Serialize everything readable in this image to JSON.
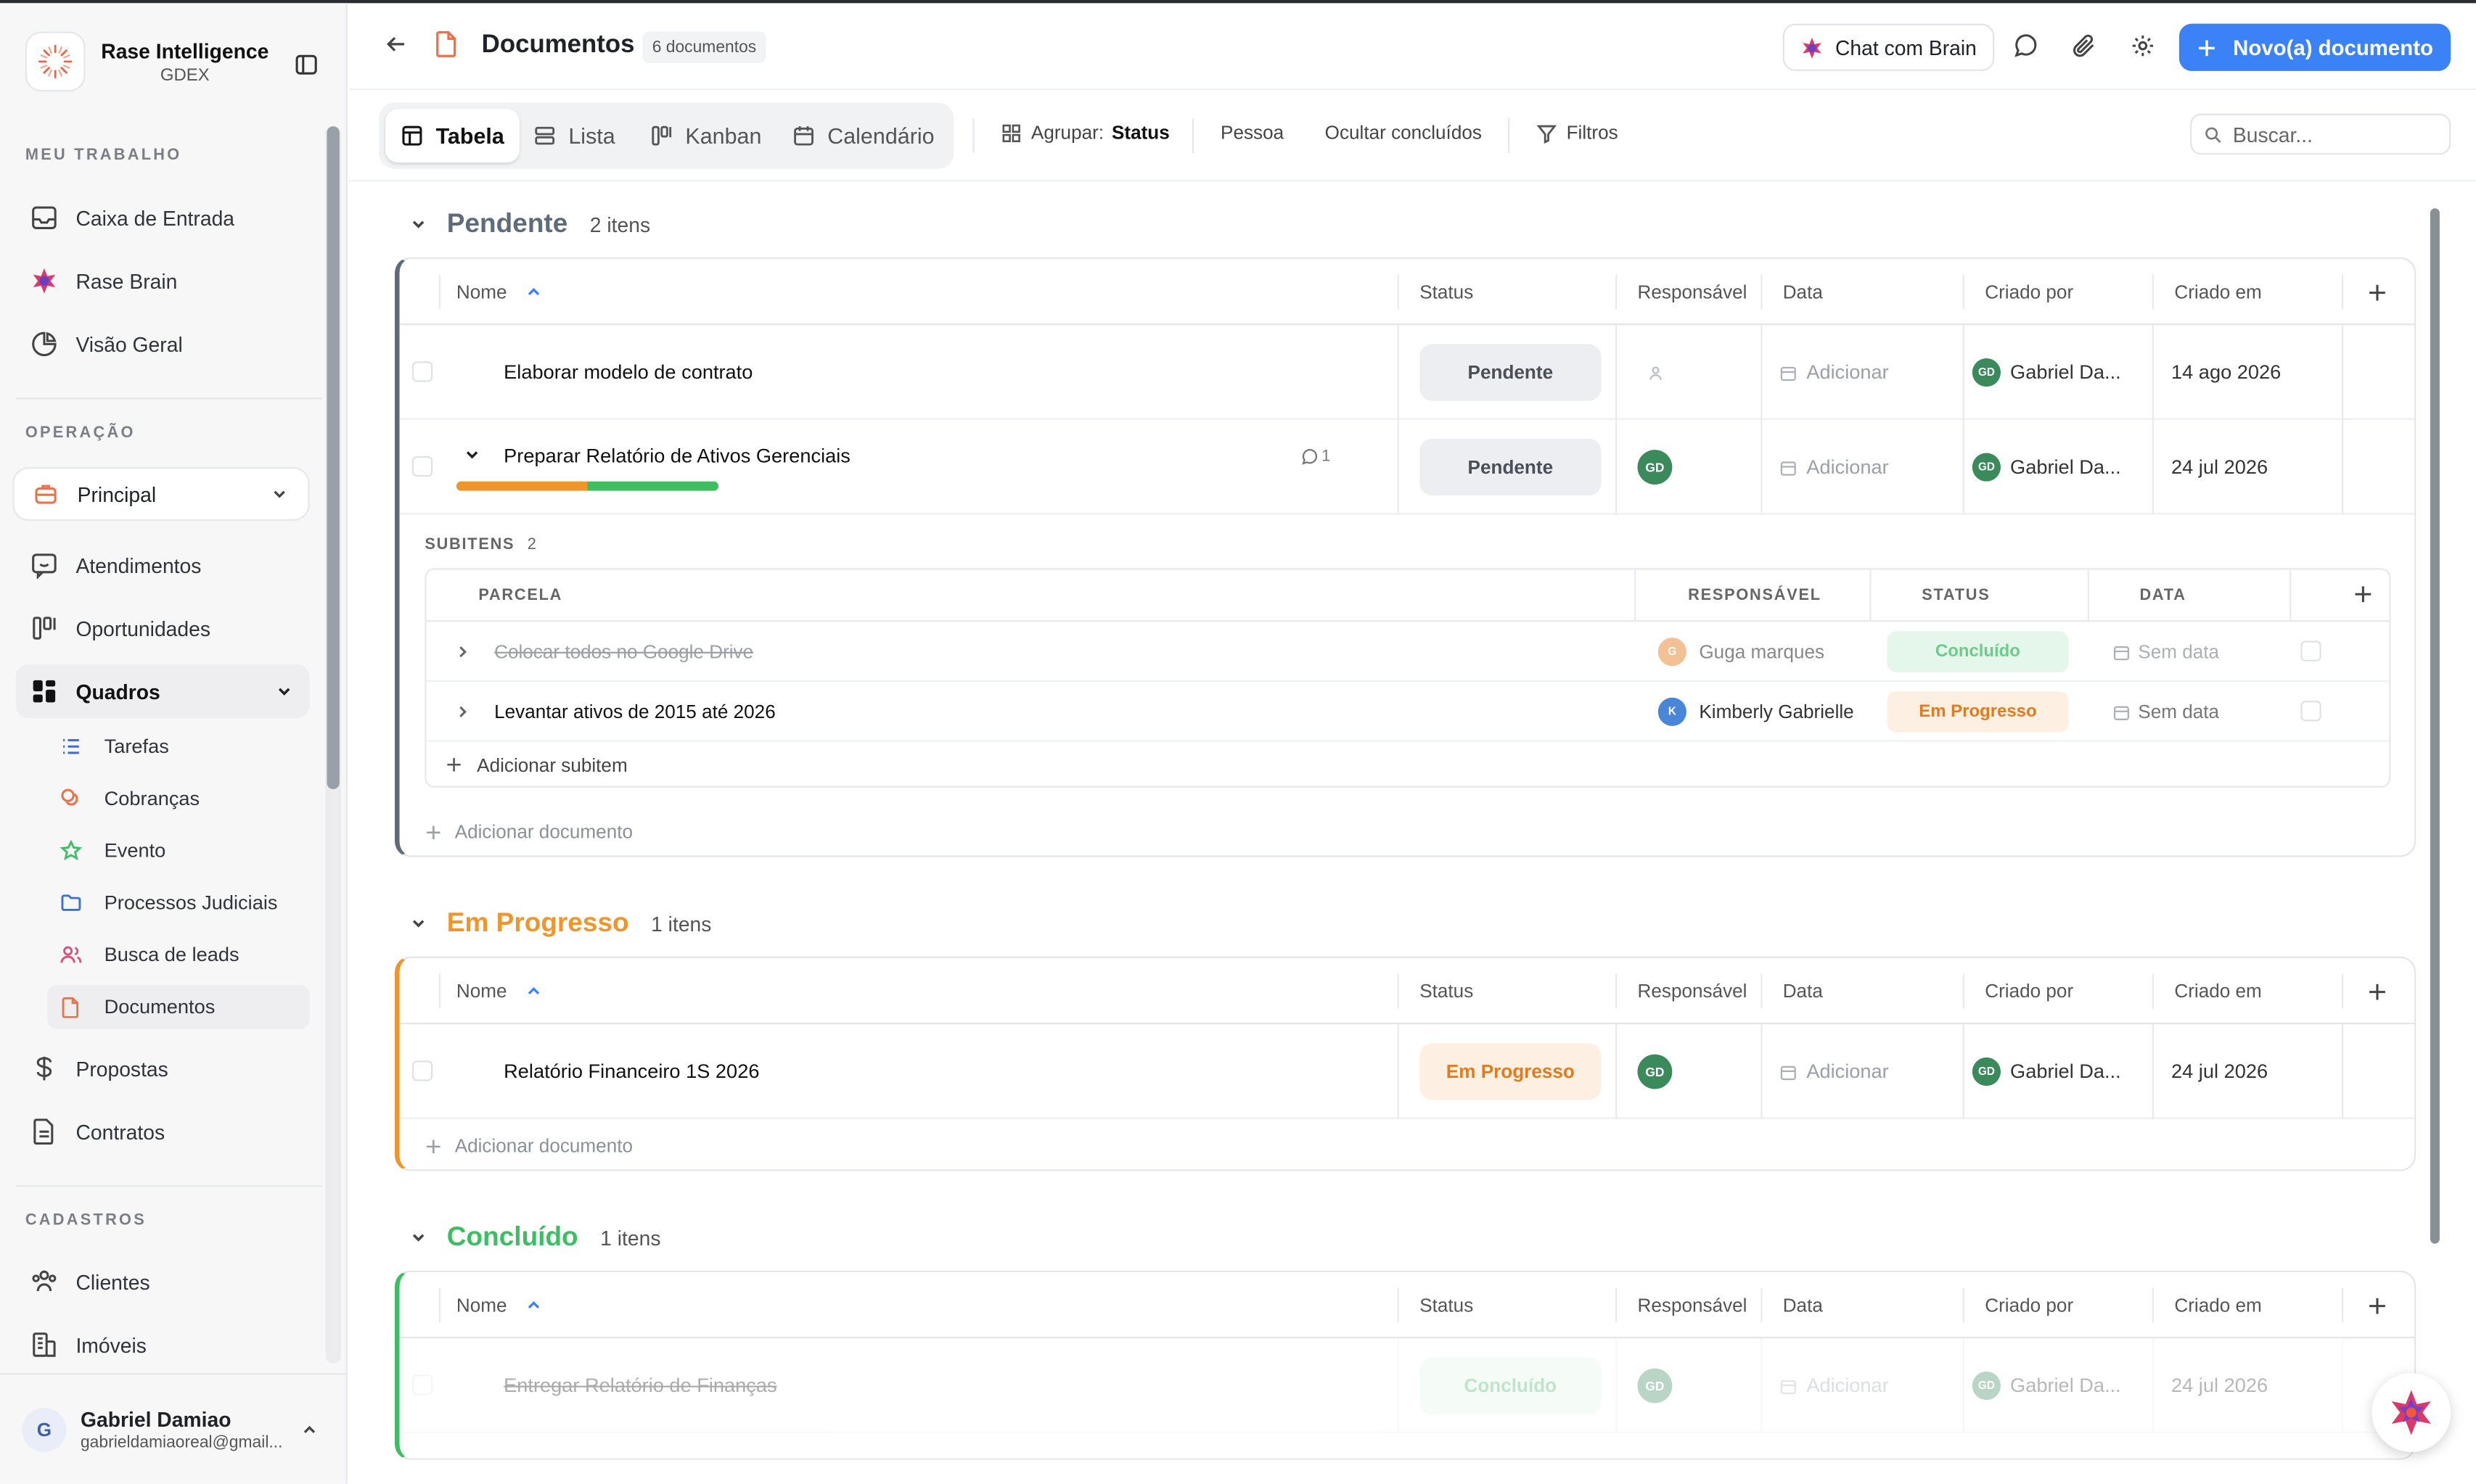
{
  "app": {
    "name": "Rase Intelligence",
    "workspace": "GDEX"
  },
  "sidebar": {
    "sections": {
      "work": "MEU TRABALHO",
      "operation": "OPERAÇÃO",
      "registry": "CADASTROS"
    },
    "work_items": [
      "Caixa de Entrada",
      "Rase Brain",
      "Visão Geral"
    ],
    "workspace_select": "Principal",
    "op_items": [
      "Atendimentos",
      "Oportunidades",
      "Quadros"
    ],
    "boards": [
      "Tarefas",
      "Cobranças",
      "Evento",
      "Processos Judiciais",
      "Busca de leads",
      "Documentos"
    ],
    "op_items_after": [
      "Propostas",
      "Contratos"
    ],
    "registry_items": [
      "Clientes",
      "Imóveis"
    ],
    "user": {
      "initial": "G",
      "name": "Gabriel Damiao",
      "email": "gabrieldamiaoreal@gmail..."
    }
  },
  "header": {
    "title": "Documentos",
    "count_badge": "6 documentos",
    "chat_button": "Chat com Brain",
    "new_button": "Novo(a) documento"
  },
  "toolbar": {
    "views": [
      "Tabela",
      "Lista",
      "Kanban",
      "Calendário"
    ],
    "active_view": "Tabela",
    "group_label": "Agrupar:",
    "group_value": "Status",
    "person": "Pessoa",
    "hide_done": "Ocultar concluídos",
    "filters": "Filtros",
    "search_placeholder": "Buscar..."
  },
  "columns": [
    "Nome",
    "Status",
    "Responsável",
    "Data",
    "Criado por",
    "Criado em"
  ],
  "groups": [
    {
      "title": "Pendente",
      "count": "2 itens",
      "color": "#5f6b7a",
      "rows": [
        {
          "name": "Elaborar modelo de contrato",
          "status": "Pendente",
          "date": "Adicionar",
          "created_by": "Gabriel Da...",
          "created_at": "14 ago 2026",
          "assignee": ""
        },
        {
          "name": "Preparar Relatório de Ativos Gerenciais",
          "status": "Pendente",
          "comments": "1",
          "date": "Adicionar",
          "created_by": "Gabriel Da...",
          "created_at": "24 jul 2026",
          "assignee": "GD",
          "progress": [
            0.5,
            0.5
          ]
        }
      ],
      "subitems": {
        "label": "SUBITENS",
        "count": "2",
        "columns": [
          "PARCELA",
          "RESPONSÁVEL",
          "STATUS",
          "DATA"
        ],
        "rows": [
          {
            "name": "Colocar todos no Google Drive",
            "assignee_initial": "G",
            "assignee": "Guga marques",
            "status": "Concluído",
            "date": "Sem data",
            "done": true
          },
          {
            "name": "Levantar ativos de 2015 até 2026",
            "assignee_initial": "K",
            "assignee": "Kimberly Gabrielle",
            "status": "Em Progresso",
            "date": "Sem data",
            "done": false
          }
        ],
        "add": "Adicionar subitem"
      },
      "add": "Adicionar documento"
    },
    {
      "title": "Em Progresso",
      "count": "1 itens",
      "color": "#f0952b",
      "rows": [
        {
          "name": "Relatório Financeiro 1S 2026",
          "status": "Em Progresso",
          "date": "Adicionar",
          "created_by": "Gabriel Da...",
          "created_at": "24 jul 2026",
          "assignee": "GD"
        }
      ],
      "add": "Adicionar documento"
    },
    {
      "title": "Concluído",
      "count": "1 itens",
      "color": "#3fbd63",
      "rows": [
        {
          "name": "Entregar Relatório de Finanças",
          "status": "Concluído",
          "date": "Adicionar",
          "created_by": "Gabriel Da...",
          "created_at": "24 jul 2026",
          "assignee": "GD"
        }
      ]
    }
  ],
  "avatar_initials": "GD",
  "colors": {
    "primary": "#3b82f6",
    "pending": "#5f6b7a",
    "progress": "#f0952b",
    "done": "#3fbd63"
  }
}
